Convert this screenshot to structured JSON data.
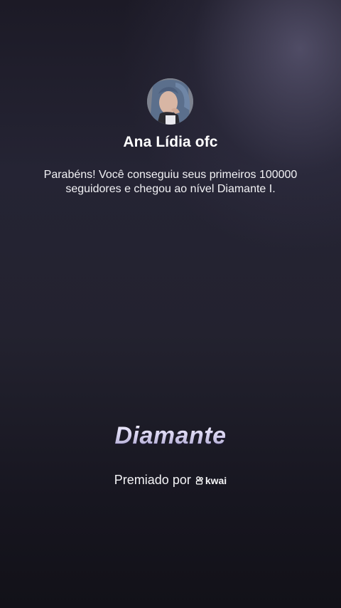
{
  "profile": {
    "name": "Ana Lídia ofc"
  },
  "message": {
    "text": "Parabéns! Você conseguiu seus primeiros 100000 seguidores e chegou ao nível Diamante I."
  },
  "badge": {
    "title": "Diamante"
  },
  "award": {
    "prefix": "Premiado por",
    "brand": "kwai",
    "brand_icon": "kwai-logo-icon"
  },
  "colors": {
    "background_top": "#1c1a26",
    "background_bottom": "#121118",
    "badge_text": "#d9d4f0",
    "text": "#ffffff"
  }
}
